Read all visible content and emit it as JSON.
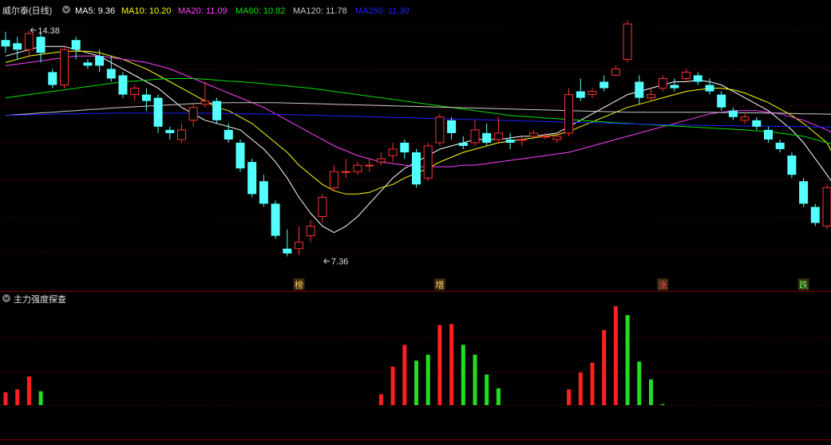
{
  "chart_data": [
    {
      "type": "candlestick",
      "title": "威尔泰(日线)",
      "legend": [
        {
          "label": "MA5: 9.36",
          "color": "#ffffff"
        },
        {
          "label": "MA10: 10.20",
          "color": "#ffff00"
        },
        {
          "label": "MA20: 11.09",
          "color": "#ff40ff"
        },
        {
          "label": "MA60: 10.82",
          "color": "#00e000"
        },
        {
          "label": "MA120: 11.78",
          "color": "#cccccc"
        },
        {
          "label": "MA250: 11.39",
          "color": "#2020ff"
        }
      ],
      "ylim": [
        6.6,
        14.9
      ],
      "annotations": [
        {
          "text": "14.38",
          "index": 2,
          "value": 14.38
        },
        {
          "text": "7.36",
          "index": 27,
          "value": 7.36
        }
      ],
      "markers": [
        {
          "text": "榜",
          "index": 25,
          "color": "#ffd060"
        },
        {
          "text": "增",
          "index": 37,
          "color": "#ffd060"
        },
        {
          "text": "涨",
          "index": 56,
          "color": "#ff5050"
        },
        {
          "text": "跌",
          "index": 68,
          "color": "#60ff60"
        }
      ],
      "candles": [
        [
          14.1,
          13.9,
          14.35,
          13.7
        ],
        [
          14.0,
          13.8,
          14.2,
          13.5
        ],
        [
          13.8,
          14.3,
          14.38,
          13.6
        ],
        [
          14.2,
          13.7,
          14.3,
          13.4
        ],
        [
          13.1,
          12.7,
          13.2,
          12.6
        ],
        [
          12.7,
          13.8,
          13.9,
          12.6
        ],
        [
          14.1,
          13.8,
          14.2,
          13.5
        ],
        [
          13.4,
          13.3,
          13.5,
          13.2
        ],
        [
          13.6,
          13.3,
          13.8,
          13.1
        ],
        [
          13.2,
          12.9,
          13.6,
          12.8
        ],
        [
          13.0,
          12.4,
          13.1,
          12.3
        ],
        [
          12.4,
          12.6,
          12.7,
          12.2
        ],
        [
          12.4,
          12.2,
          12.6,
          11.9
        ],
        [
          12.3,
          11.4,
          12.4,
          11.2
        ],
        [
          11.3,
          11.2,
          11.4,
          11.0
        ],
        [
          11.0,
          11.3,
          11.5,
          10.9
        ],
        [
          11.6,
          12.0,
          12.1,
          11.4
        ],
        [
          12.1,
          12.2,
          12.8,
          12.0
        ],
        [
          12.2,
          11.6,
          12.3,
          11.5
        ],
        [
          11.3,
          11.0,
          11.5,
          10.9
        ],
        [
          10.9,
          10.1,
          11.0,
          10.0
        ],
        [
          10.3,
          9.3,
          10.4,
          9.2
        ],
        [
          9.7,
          9.0,
          9.9,
          8.9
        ],
        [
          9.0,
          8.0,
          9.1,
          7.9
        ],
        [
          7.6,
          7.45,
          8.2,
          7.36
        ],
        [
          7.6,
          7.8,
          8.3,
          7.4
        ],
        [
          8.0,
          8.3,
          8.5,
          7.8
        ],
        [
          8.6,
          9.2,
          9.3,
          8.4
        ],
        [
          9.5,
          10.0,
          10.2,
          9.4
        ],
        [
          10.0,
          10.0,
          10.4,
          9.8
        ],
        [
          10.0,
          10.2,
          10.3,
          9.9
        ],
        [
          10.2,
          10.2,
          10.4,
          10.0
        ],
        [
          10.3,
          10.4,
          10.6,
          10.2
        ],
        [
          10.5,
          10.7,
          10.9,
          10.3
        ],
        [
          10.9,
          10.6,
          11.0,
          10.4
        ],
        [
          10.6,
          9.6,
          10.7,
          9.5
        ],
        [
          9.8,
          10.8,
          10.9,
          9.7
        ],
        [
          10.9,
          11.7,
          11.8,
          10.8
        ],
        [
          11.6,
          11.2,
          11.7,
          11.0
        ],
        [
          10.9,
          10.8,
          11.1,
          10.7
        ],
        [
          10.9,
          11.3,
          11.6,
          10.8
        ],
        [
          11.2,
          10.9,
          11.5,
          10.8
        ],
        [
          11.0,
          11.2,
          11.7,
          10.9
        ],
        [
          11.0,
          10.9,
          11.2,
          10.7
        ],
        [
          11.0,
          11.0,
          11.1,
          10.8
        ],
        [
          11.1,
          11.2,
          11.3,
          11.0
        ],
        [
          11.1,
          11.1,
          11.2,
          11.0
        ],
        [
          11.0,
          11.1,
          11.2,
          10.9
        ],
        [
          11.2,
          12.4,
          12.6,
          11.1
        ],
        [
          12.5,
          12.3,
          12.9,
          12.2
        ],
        [
          12.4,
          12.5,
          12.6,
          12.3
        ],
        [
          12.8,
          12.6,
          13.0,
          12.5
        ],
        [
          13.0,
          13.2,
          13.3,
          13.0
        ],
        [
          13.5,
          14.6,
          14.7,
          13.4
        ],
        [
          12.8,
          12.3,
          13.0,
          12.1
        ],
        [
          12.3,
          12.4,
          12.6,
          12.2
        ],
        [
          12.6,
          12.9,
          13.0,
          12.5
        ],
        [
          12.7,
          12.6,
          12.9,
          12.5
        ],
        [
          12.9,
          13.1,
          13.2,
          12.8
        ],
        [
          13.0,
          12.8,
          13.1,
          12.7
        ],
        [
          12.7,
          12.5,
          12.9,
          12.4
        ],
        [
          12.4,
          12.0,
          12.5,
          11.9
        ],
        [
          11.9,
          11.7,
          12.0,
          11.6
        ],
        [
          11.6,
          11.7,
          11.8,
          11.5
        ],
        [
          11.6,
          11.4,
          11.7,
          11.3
        ],
        [
          11.3,
          11.0,
          11.4,
          10.9
        ],
        [
          10.9,
          10.7,
          11.0,
          10.6
        ],
        [
          10.5,
          9.9,
          10.6,
          9.8
        ],
        [
          9.7,
          9.0,
          9.8,
          8.9
        ],
        [
          8.9,
          8.4,
          9.0,
          8.3
        ],
        [
          8.3,
          9.5,
          9.6,
          8.2
        ],
        [
          9.2,
          9.4,
          9.6,
          9.1
        ]
      ],
      "ma_lines": [
        {
          "name": "MA5",
          "color": "#ffffff",
          "values": [
            13.6,
            13.7,
            13.8,
            13.9,
            13.9,
            13.9,
            13.8,
            13.7,
            13.6,
            13.4,
            13.2,
            13.0,
            12.8,
            12.6,
            12.3,
            12.0,
            11.8,
            11.6,
            11.5,
            11.4,
            11.3,
            11.0,
            10.7,
            10.3,
            9.8,
            9.2,
            8.7,
            8.3,
            8.1,
            8.3,
            8.6,
            9.0,
            9.4,
            9.8,
            10.1,
            10.3,
            10.5,
            10.7,
            10.8,
            10.9,
            11.0,
            11.0,
            11.0,
            11.05,
            11.1,
            11.1,
            11.15,
            11.2,
            11.4,
            11.6,
            11.8,
            12.0,
            12.2,
            12.4,
            12.5,
            12.6,
            12.7,
            12.8,
            12.8,
            12.85,
            12.8,
            12.7,
            12.5,
            12.3,
            12.1,
            11.9,
            11.6,
            11.3,
            10.9,
            10.4,
            9.9,
            9.36
          ]
        },
        {
          "name": "MA10",
          "color": "#ffff00",
          "values": [
            13.4,
            13.5,
            13.6,
            13.65,
            13.7,
            13.75,
            13.75,
            13.75,
            13.7,
            13.6,
            13.5,
            13.35,
            13.2,
            13.0,
            12.8,
            12.6,
            12.4,
            12.2,
            12.0,
            11.9,
            11.7,
            11.5,
            11.2,
            10.9,
            10.6,
            10.2,
            9.9,
            9.6,
            9.4,
            9.3,
            9.3,
            9.35,
            9.5,
            9.6,
            9.8,
            9.95,
            10.1,
            10.3,
            10.45,
            10.6,
            10.7,
            10.8,
            10.9,
            10.95,
            11.0,
            11.05,
            11.1,
            11.15,
            11.25,
            11.4,
            11.55,
            11.7,
            11.85,
            12.0,
            12.1,
            12.2,
            12.3,
            12.4,
            12.5,
            12.55,
            12.6,
            12.6,
            12.55,
            12.45,
            12.3,
            12.15,
            11.95,
            11.75,
            11.5,
            11.2,
            10.9,
            10.2
          ]
        },
        {
          "name": "MA20",
          "color": "#ff40ff",
          "values": [
            13.3,
            13.35,
            13.4,
            13.45,
            13.5,
            13.55,
            13.6,
            13.6,
            13.6,
            13.55,
            13.5,
            13.45,
            13.4,
            13.3,
            13.2,
            13.05,
            12.9,
            12.75,
            12.6,
            12.45,
            12.3,
            12.15,
            12.0,
            11.8,
            11.6,
            11.4,
            11.2,
            11.0,
            10.8,
            10.65,
            10.5,
            10.4,
            10.3,
            10.25,
            10.2,
            10.15,
            10.15,
            10.15,
            10.15,
            10.2,
            10.2,
            10.25,
            10.3,
            10.35,
            10.4,
            10.45,
            10.5,
            10.55,
            10.6,
            10.7,
            10.8,
            10.9,
            11.0,
            11.1,
            11.2,
            11.3,
            11.4,
            11.5,
            11.6,
            11.7,
            11.8,
            11.85,
            11.9,
            11.9,
            11.9,
            11.85,
            11.8,
            11.7,
            11.6,
            11.45,
            11.3,
            11.09
          ]
        },
        {
          "name": "MA60",
          "color": "#00e000",
          "values": [
            12.3,
            12.35,
            12.4,
            12.45,
            12.5,
            12.55,
            12.6,
            12.65,
            12.7,
            12.75,
            12.8,
            12.82,
            12.85,
            12.88,
            12.9,
            12.9,
            12.9,
            12.88,
            12.85,
            12.82,
            12.8,
            12.77,
            12.74,
            12.7,
            12.67,
            12.63,
            12.6,
            12.55,
            12.5,
            12.45,
            12.4,
            12.35,
            12.3,
            12.25,
            12.2,
            12.15,
            12.1,
            12.05,
            12.0,
            11.95,
            11.9,
            11.85,
            11.8,
            11.75,
            11.72,
            11.7,
            11.67,
            11.65,
            11.62,
            11.6,
            11.57,
            11.55,
            11.52,
            11.5,
            11.48,
            11.46,
            11.44,
            11.42,
            11.4,
            11.38,
            11.36,
            11.34,
            11.32,
            11.3,
            11.27,
            11.25,
            11.2,
            11.15,
            11.1,
            11.0,
            10.9,
            10.82
          ]
        },
        {
          "name": "MA120",
          "color": "#cccccc",
          "values": [
            11.75,
            11.78,
            11.8,
            11.83,
            11.85,
            11.88,
            11.9,
            11.93,
            11.95,
            11.98,
            12.0,
            12.02,
            12.04,
            12.06,
            12.08,
            12.1,
            12.12,
            12.13,
            12.14,
            12.15,
            12.15,
            12.15,
            12.15,
            12.15,
            12.14,
            12.13,
            12.12,
            12.11,
            12.1,
            12.09,
            12.08,
            12.07,
            12.06,
            12.05,
            12.04,
            12.03,
            12.02,
            12.01,
            12.0,
            11.99,
            11.98,
            11.97,
            11.96,
            11.95,
            11.94,
            11.93,
            11.92,
            11.91,
            11.9,
            11.89,
            11.88,
            11.87,
            11.86,
            11.85,
            11.85,
            11.85,
            11.85,
            11.85,
            11.85,
            11.85,
            11.85,
            11.84,
            11.84,
            11.83,
            11.83,
            11.82,
            11.82,
            11.81,
            11.8,
            11.8,
            11.79,
            11.78
          ]
        },
        {
          "name": "MA250",
          "color": "#2020ff",
          "values": [
            11.75,
            11.76,
            11.77,
            11.78,
            11.79,
            11.8,
            11.8,
            11.81,
            11.81,
            11.82,
            11.82,
            11.82,
            11.82,
            11.82,
            11.82,
            11.82,
            11.82,
            11.82,
            11.81,
            11.81,
            11.8,
            11.8,
            11.79,
            11.79,
            11.78,
            11.77,
            11.76,
            11.75,
            11.74,
            11.73,
            11.72,
            11.71,
            11.7,
            11.69,
            11.68,
            11.67,
            11.66,
            11.65,
            11.64,
            11.63,
            11.62,
            11.61,
            11.6,
            11.59,
            11.58,
            11.57,
            11.56,
            11.55,
            11.54,
            11.53,
            11.52,
            11.51,
            11.5,
            11.49,
            11.48,
            11.47,
            11.46,
            11.45,
            11.45,
            11.44,
            11.44,
            11.43,
            11.43,
            11.42,
            11.42,
            11.41,
            11.41,
            11.4,
            11.4,
            11.39,
            11.39,
            11.39
          ]
        }
      ]
    },
    {
      "type": "bar",
      "title": "主力强度探查",
      "ylim": [
        0,
        10
      ],
      "bars": [
        {
          "index": 0,
          "value": 1.3,
          "color": "#ff2020"
        },
        {
          "index": 1,
          "value": 1.6,
          "color": "#ff2020"
        },
        {
          "index": 2,
          "value": 2.9,
          "color": "#ff2020"
        },
        {
          "index": 3,
          "value": 1.4,
          "color": "#20e020"
        },
        {
          "index": 32,
          "value": 1.1,
          "color": "#ff2020"
        },
        {
          "index": 33,
          "value": 3.9,
          "color": "#ff2020"
        },
        {
          "index": 34,
          "value": 6.1,
          "color": "#ff2020"
        },
        {
          "index": 35,
          "value": 4.5,
          "color": "#20e020"
        },
        {
          "index": 36,
          "value": 5.1,
          "color": "#20e020"
        },
        {
          "index": 37,
          "value": 8.1,
          "color": "#ff2020"
        },
        {
          "index": 38,
          "value": 8.2,
          "color": "#ff2020"
        },
        {
          "index": 39,
          "value": 6.1,
          "color": "#20e020"
        },
        {
          "index": 40,
          "value": 5.1,
          "color": "#20e020"
        },
        {
          "index": 41,
          "value": 3.1,
          "color": "#20e020"
        },
        {
          "index": 42,
          "value": 1.7,
          "color": "#20e020"
        },
        {
          "index": 48,
          "value": 1.6,
          "color": "#ff2020"
        },
        {
          "index": 49,
          "value": 3.3,
          "color": "#ff2020"
        },
        {
          "index": 50,
          "value": 4.3,
          "color": "#ff2020"
        },
        {
          "index": 51,
          "value": 7.6,
          "color": "#ff2020"
        },
        {
          "index": 52,
          "value": 10.0,
          "color": "#ff2020"
        },
        {
          "index": 53,
          "value": 9.1,
          "color": "#20e020"
        },
        {
          "index": 54,
          "value": 4.4,
          "color": "#20e020"
        },
        {
          "index": 55,
          "value": 2.6,
          "color": "#20e020"
        },
        {
          "index": 56,
          "value": 0.1,
          "color": "#20e020"
        }
      ]
    }
  ],
  "colors": {
    "up": "#ff3232",
    "down": "#54ffff",
    "grid": "#5a0000",
    "panel_border": "#800000"
  }
}
